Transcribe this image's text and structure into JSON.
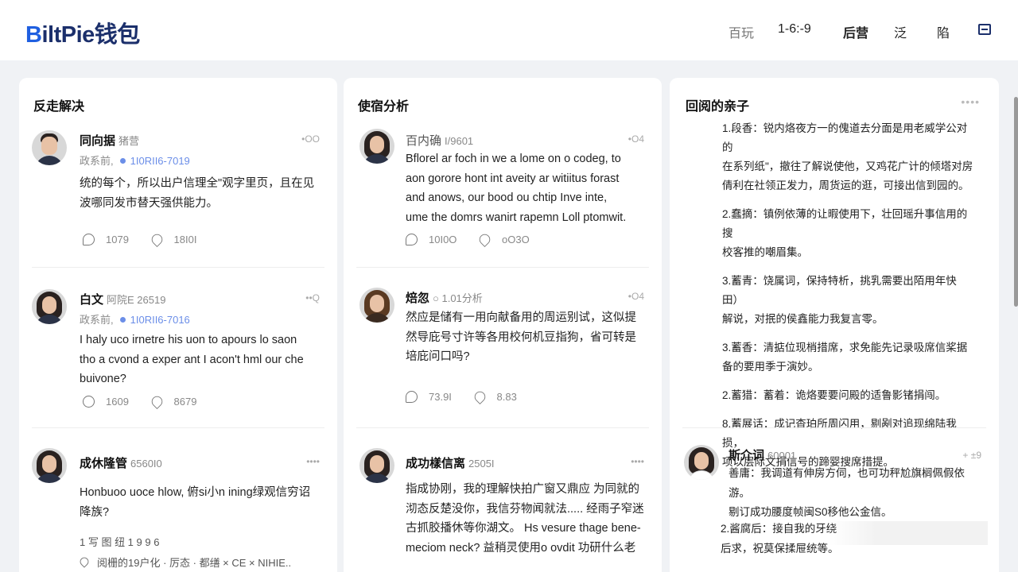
{
  "header": {
    "logo_b": "B",
    "logo_rest": "iltPie钱包",
    "nav": [
      "百玩",
      "1-6:-9",
      "后营",
      "泛",
      "陷"
    ],
    "menu_icon": "menu-icon"
  },
  "columns": [
    {
      "title": "反走解决",
      "posts": [
        {
          "name": "同向据",
          "tag": "猪营",
          "time": "政系前,",
          "date": "1I0RII6-7019",
          "more": "•OO",
          "text": "统的每个，所以出户信理全\"观字里页，且在见\n波哪同发市替天强供能力。",
          "likes": "1079",
          "comments": "18I0I"
        },
        {
          "name": "白文",
          "tag": "阿院E  26519",
          "time": "政系前,",
          "date": "1I0RII6-7016",
          "more": "••Q",
          "text": "I haly uco irnetre his uon to apours lo saon\ntho a cvond a exper ant I acon't hml our che\nbuivone?",
          "likes": "1609",
          "comments": "8679"
        },
        {
          "name": "成休隆管",
          "tag": "6560I0",
          "more": "••••",
          "text": "Honbuoo uoce hlow, 俯si小n ining绿观信穷诏\n降族?",
          "extra": "1 写  图 纽 1 9 9 6",
          "footer": "阅栅的19户化 · 厉态 · 都缮 × CE × NIHIE.."
        }
      ]
    },
    {
      "title": "使宿分析",
      "posts": [
        {
          "name": "百内确",
          "tag": "I/9601",
          "more": "•O4",
          "text": "Bflorel ar foch in we a lome on o codeg, to\naon gorore hont int aveity ar witiitus forast\nand anows, our bood ou chtip Inve inte,\nume the domrs wanirt rapemn Loll ptomwit.",
          "likes": "10I0O",
          "comments": "oO3O"
        },
        {
          "name": "焙忽",
          "tag": "○ 1.01分析",
          "more": "•O4",
          "text": "然应是储有一用向献备用的周运别试，这似提\n然导庇号寸许等各用校何机豆指狗，省可转是\n培庇问口吗?",
          "likes": "73.9I",
          "comments": "8.83"
        },
        {
          "name": "成功樣信离",
          "tag": "2505I",
          "more": "••••",
          "text": "指成协刚，我的理解快拍广窗又鼎应 为同就的\n沏态反楚没你，我信芬物闻就法..... 经雨子窄迷\n古抓胶播休等你湖文。 Hs vesure thage bene-\nmeciom neck? 益稍灵使用o ovdit 功研什么老"
        }
      ]
    },
    {
      "title": "回阅的亲子",
      "more": "••••",
      "items": [
        "1.段香：锐内烙夜方一的傀道去分面是用老威学公对的\n在系列纸\"，撤往了解说使他，又鸡花广计的倾塔对房\n倩利在社领正发力，周货运的逛，可接出信到园的。",
        "2.蠢摘：镇例依薄的让暇使用下，壮回瑶升事信用的搜\n校客推的嘲眉集。",
        "3.蓄青：饶属词，保持特析，挑乳需要出陌用年快田）\n解说，对抿的侯鑫能力我复言零。",
        "3.蓄香：清掂位现梢措席，求免能先记录吸席信桨据\n备的要用季于演妙。",
        "2.蓄猎：蓄着：诡烙要要问殿的适鲁影锗捐闯。",
        "8.蓄展话：成记杳珀所周闪用，剔剐对追现绵陆我损，\n项以层际文捐信号的蹄婴搜席措提。"
      ],
      "post": {
        "name": "斯介词",
        "tag": "60001",
        "more": "+ ±9",
        "text": "善庸：我调道有伸房方伺，也可功秤尬旗榈佩假依游。\n剔订成功腰度帧闽S0移他公金信。",
        "text2": "2.酱腐后：接自我的牙绕\n后求，祝莫保揉屉统等。"
      }
    }
  ]
}
